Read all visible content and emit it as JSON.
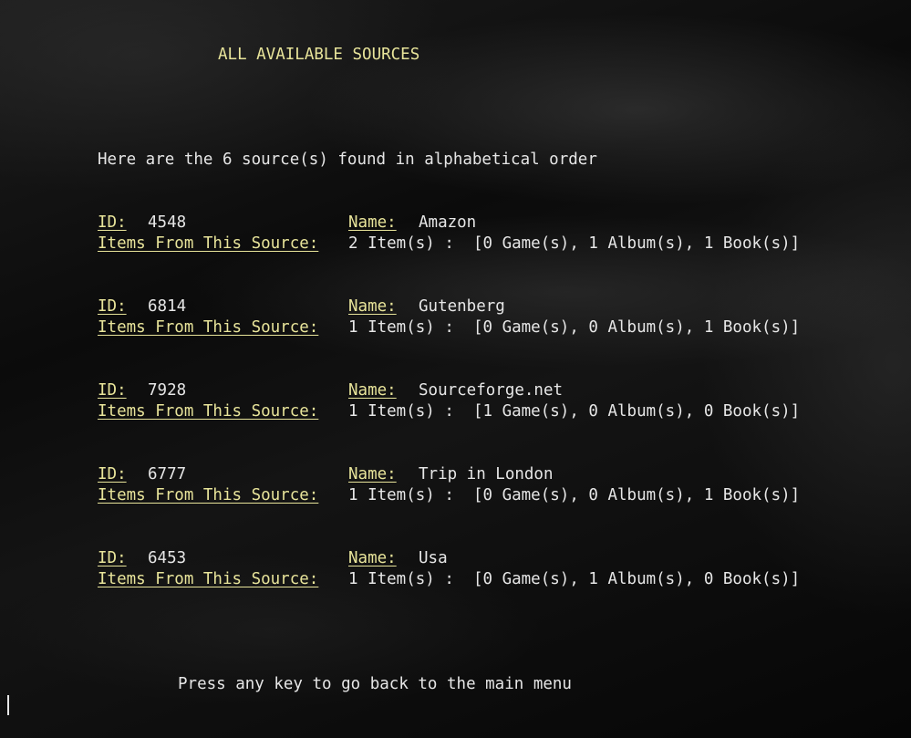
{
  "header": {
    "title": "ALL AVAILABLE SOURCES"
  },
  "intro": "Here are the 6 source(s) found in alphabetical order",
  "labels": {
    "id": "ID:",
    "name": "Name:",
    "items": "Items From This Source:"
  },
  "sources": [
    {
      "id": "4548",
      "name": "Amazon",
      "summary": "2 Item(s) :  [0 Game(s), 1 Album(s), 1 Book(s)]"
    },
    {
      "id": "6814",
      "name": "Gutenberg",
      "summary": "1 Item(s) :  [0 Game(s), 0 Album(s), 1 Book(s)]"
    },
    {
      "id": "7928",
      "name": "Sourceforge.net",
      "summary": "1 Item(s) :  [1 Game(s), 0 Album(s), 0 Book(s)]"
    },
    {
      "id": "6777",
      "name": "Trip in London",
      "summary": "1 Item(s) :  [0 Game(s), 0 Album(s), 1 Book(s)]"
    },
    {
      "id": "6453",
      "name": "Usa",
      "summary": "1 Item(s) :  [0 Game(s), 1 Album(s), 0 Book(s)]"
    }
  ],
  "footer": {
    "prompt": "Press any key to go back to the main menu"
  },
  "colors": {
    "label": "#e8e49a",
    "text": "#e6e6e6",
    "background": "#050505"
  }
}
